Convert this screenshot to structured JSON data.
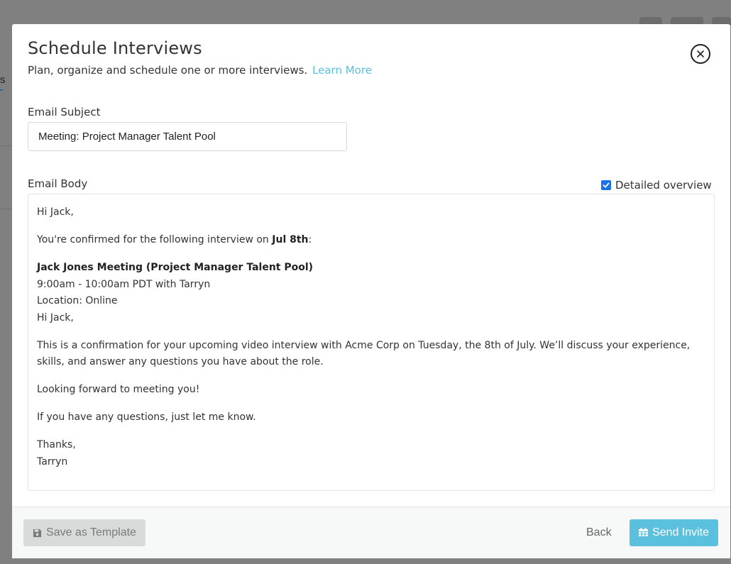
{
  "background": {
    "tab_fragment": "s"
  },
  "modal": {
    "title": "Schedule Interviews",
    "subtitle": "Plan, organize and schedule one or more interviews.",
    "learn_more": "Learn More",
    "close_icon": "close-circle-icon"
  },
  "form": {
    "subject_label": "Email Subject",
    "subject_value": "Meeting: Project Manager Talent Pool",
    "body_label": "Email Body",
    "detailed_overview_label": "Detailed overview",
    "detailed_overview_checked": true
  },
  "email": {
    "greeting": "Hi Jack,",
    "confirm_prefix": "You're confirmed for the following interview on ",
    "confirm_date": "Jul 8th",
    "confirm_suffix": ":",
    "meeting_title": "Jack Jones Meeting (Project Manager Talent Pool)",
    "meeting_time": "9:00am - 10:00am PDT with Tarryn",
    "meeting_location": "Location: Online",
    "greeting2": "Hi Jack,",
    "paragraph1": "This is a confirmation for your upcoming video interview with Acme Corp on Tuesday, the 8th of July. We’ll discuss your experience, skills, and answer any questions you have about the role.",
    "paragraph2": "Looking forward to meeting you!",
    "paragraph3": "If you have any questions, just let me know.",
    "signoff": "Thanks,",
    "signature": "Tarryn"
  },
  "footer": {
    "save_template_label": "Save as Template",
    "save_icon": "floppy-disk-icon",
    "back_label": "Back",
    "send_invite_label": "Send Invite",
    "send_icon": "calendar-icon"
  },
  "colors": {
    "accent": "#5bc0de",
    "checkbox": "#1a73e8",
    "overlay": "#808080"
  }
}
